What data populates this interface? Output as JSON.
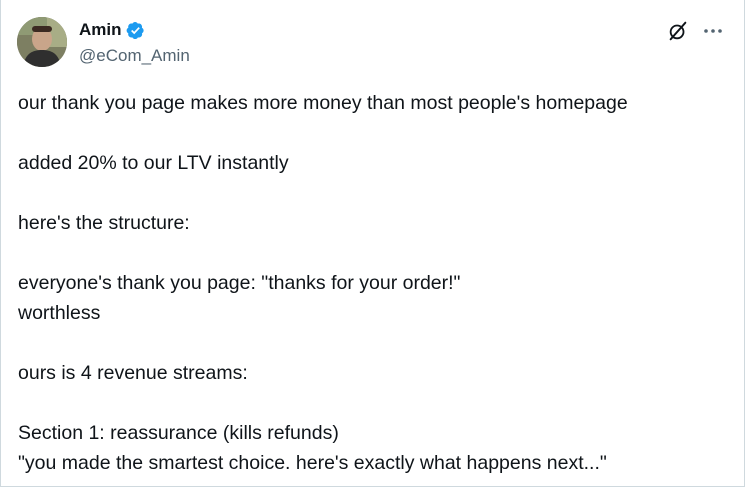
{
  "author": {
    "name": "Amin",
    "handle": "@eCom_Amin",
    "verified": true
  },
  "icons": {
    "verified": "verified-badge-icon",
    "grok": "grok-icon",
    "more": "more-options-icon"
  },
  "colors": {
    "verified_blue": "#1d9bf0",
    "text": "#0f1419",
    "secondary": "#536471"
  },
  "tweet": {
    "lines": [
      "our thank you page makes more money than most people's homepage",
      "",
      "added 20% to our LTV instantly",
      "",
      "here's the structure:",
      "",
      "everyone's thank you page: \"thanks for your order!\"",
      "worthless",
      "",
      "ours is 4 revenue streams:",
      "",
      "Section 1: reassurance (kills refunds)",
      "\"you made the smartest choice. here's exactly what happens next...\""
    ]
  }
}
